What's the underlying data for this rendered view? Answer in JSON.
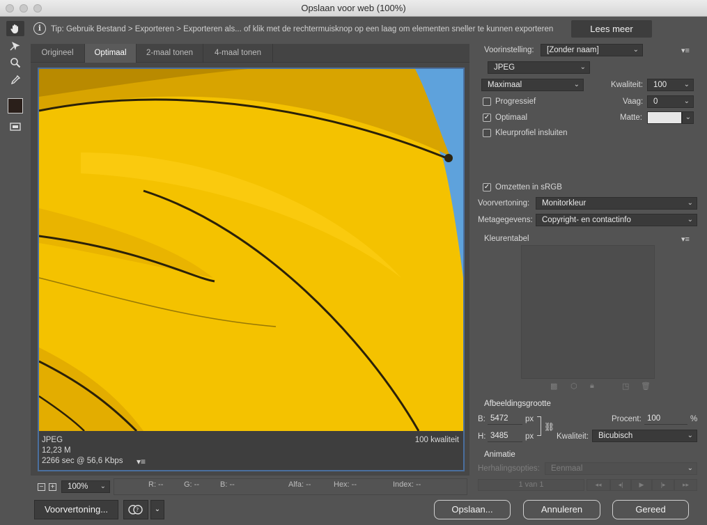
{
  "window": {
    "title": "Opslaan voor web (100%)"
  },
  "tip": {
    "text": "Tip: Gebruik Bestand > Exporteren > Exporteren als... of klik met de rechtermuisknop op een laag om elementen sneller te kunnen exporteren",
    "button": "Lees meer"
  },
  "tabs": [
    "Origineel",
    "Optimaal",
    "2-maal tonen",
    "4-maal tonen"
  ],
  "preview": {
    "format": "JPEG",
    "size": "12,23 M",
    "download_time": "2266 sec @ 56,6 Kbps",
    "quality_label": "100 kwaliteit"
  },
  "zoom": {
    "value": "100%"
  },
  "pixel_readout": {
    "r": "R: --",
    "g": "G: --",
    "b": "B: --",
    "alpha": "Alfa: --",
    "hex": "Hex: --",
    "index": "Index: --"
  },
  "bottom_buttons": {
    "preview": "Voorvertoning...",
    "save": "Opslaan...",
    "cancel": "Annuleren",
    "done": "Gereed"
  },
  "settings": {
    "preset_label": "Voorinstelling:",
    "preset_value": "[Zonder naam]",
    "format_value": "JPEG",
    "quality_preset": "Maximaal",
    "quality_label": "Kwaliteit:",
    "quality_value": "100",
    "progressive_label": "Progressief",
    "progressive_checked": false,
    "blur_label": "Vaag:",
    "blur_value": "0",
    "optimized_label": "Optimaal",
    "optimized_checked": true,
    "matte_label": "Matte:",
    "matte_color": "#e8e8e8",
    "embed_profile_label": "Kleurprofiel insluiten",
    "embed_profile_checked": false,
    "convert_srgb_label": "Omzetten in sRGB",
    "convert_srgb_checked": true,
    "preview_label": "Voorvertoning:",
    "preview_value": "Monitorkleur",
    "metadata_label": "Metagegevens:",
    "metadata_value": "Copyright- en contactinfo",
    "color_table_label": "Kleurentabel"
  },
  "image_size": {
    "heading": "Afbeeldingsgrootte",
    "w_label": "B:",
    "w_value": "5472",
    "h_label": "H:",
    "h_value": "3485",
    "unit": "px",
    "percent_label": "Procent:",
    "percent_value": "100",
    "percent_unit": "%",
    "quality_label": "Kwaliteit:",
    "quality_value": "Bicubisch"
  },
  "animation": {
    "heading": "Animatie",
    "loop_label": "Herhalingsopties:",
    "loop_value": "Eenmaal",
    "frame_counter": "1 van 1"
  },
  "colors": {
    "panel_bg": "#535353",
    "selection_border": "#4a6f9e",
    "umbrella_yellow": "#f5c400",
    "sky_blue": "#5b9fdc"
  }
}
